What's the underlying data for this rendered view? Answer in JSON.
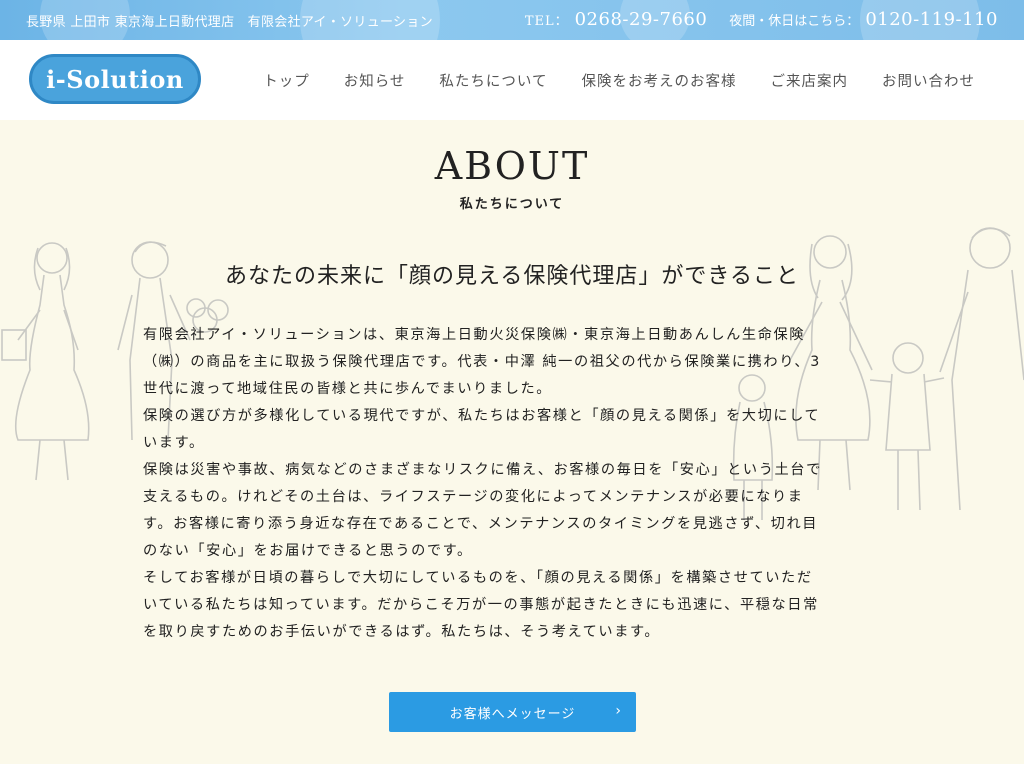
{
  "topbar": {
    "location": "長野県 上田市 東京海上日動代理店　有限会社アイ・ソリューション",
    "tel_label": "TEL：",
    "tel_number": "0268-29-7660",
    "night_label": "夜間・休日はこちら：",
    "night_number": "0120-119-110"
  },
  "header": {
    "logo_text": "i-Solution",
    "nav": [
      "トップ",
      "お知らせ",
      "私たちについて",
      "保険をお考えのお客様",
      "ご来店案内",
      "お問い合わせ"
    ]
  },
  "about": {
    "title": "ABOUT",
    "subtitle": "私たちについて",
    "headline": "あなたの未来に「顔の見える保険代理店」ができること",
    "lines": [
      "有限会社アイ・ソリューションは、東京海上日動火災保険㈱・東京海上日動あんしん生命保険",
      "（㈱）の商品を主に取扱う保険代理店です。代表・中澤 純一の祖父の代から保険業に携わり、3",
      "世代に渡って地域住民の皆様と共に歩んでまいりました。",
      "保険の選び方が多様化している現代ですが、私たちはお客様と「顔の見える関係」を大切にして",
      "います。",
      "保険は災害や事故、病気などのさまざまなリスクに備え、お客様の毎日を「安心」という土台で",
      "支えるもの。けれどその土台は、ライフステージの変化によってメンテナンスが必要になりま",
      "す。お客様に寄り添う身近な存在であることで、メンテナンスのタイミングを見逃さず、切れ目",
      "のない「安心」をお届けできると思うのです。",
      "そしてお客様が日頃の暮らしで大切にしているものを、「顔の見える関係」を構築させていただ",
      "いている私たちは知っています。だからこそ万が一の事態が起きたときにも迅速に、平穏な日常",
      "を取り戻すためのお手伝いができるはず。私たちは、そう考えています。"
    ],
    "cta_label": "お客様へメッセージ",
    "cta_chevron": "›"
  },
  "colors": {
    "topbar": "#7dbde9",
    "logo": "#4aa3dc",
    "cta": "#2b9be3",
    "background": "#fbf9ea"
  }
}
